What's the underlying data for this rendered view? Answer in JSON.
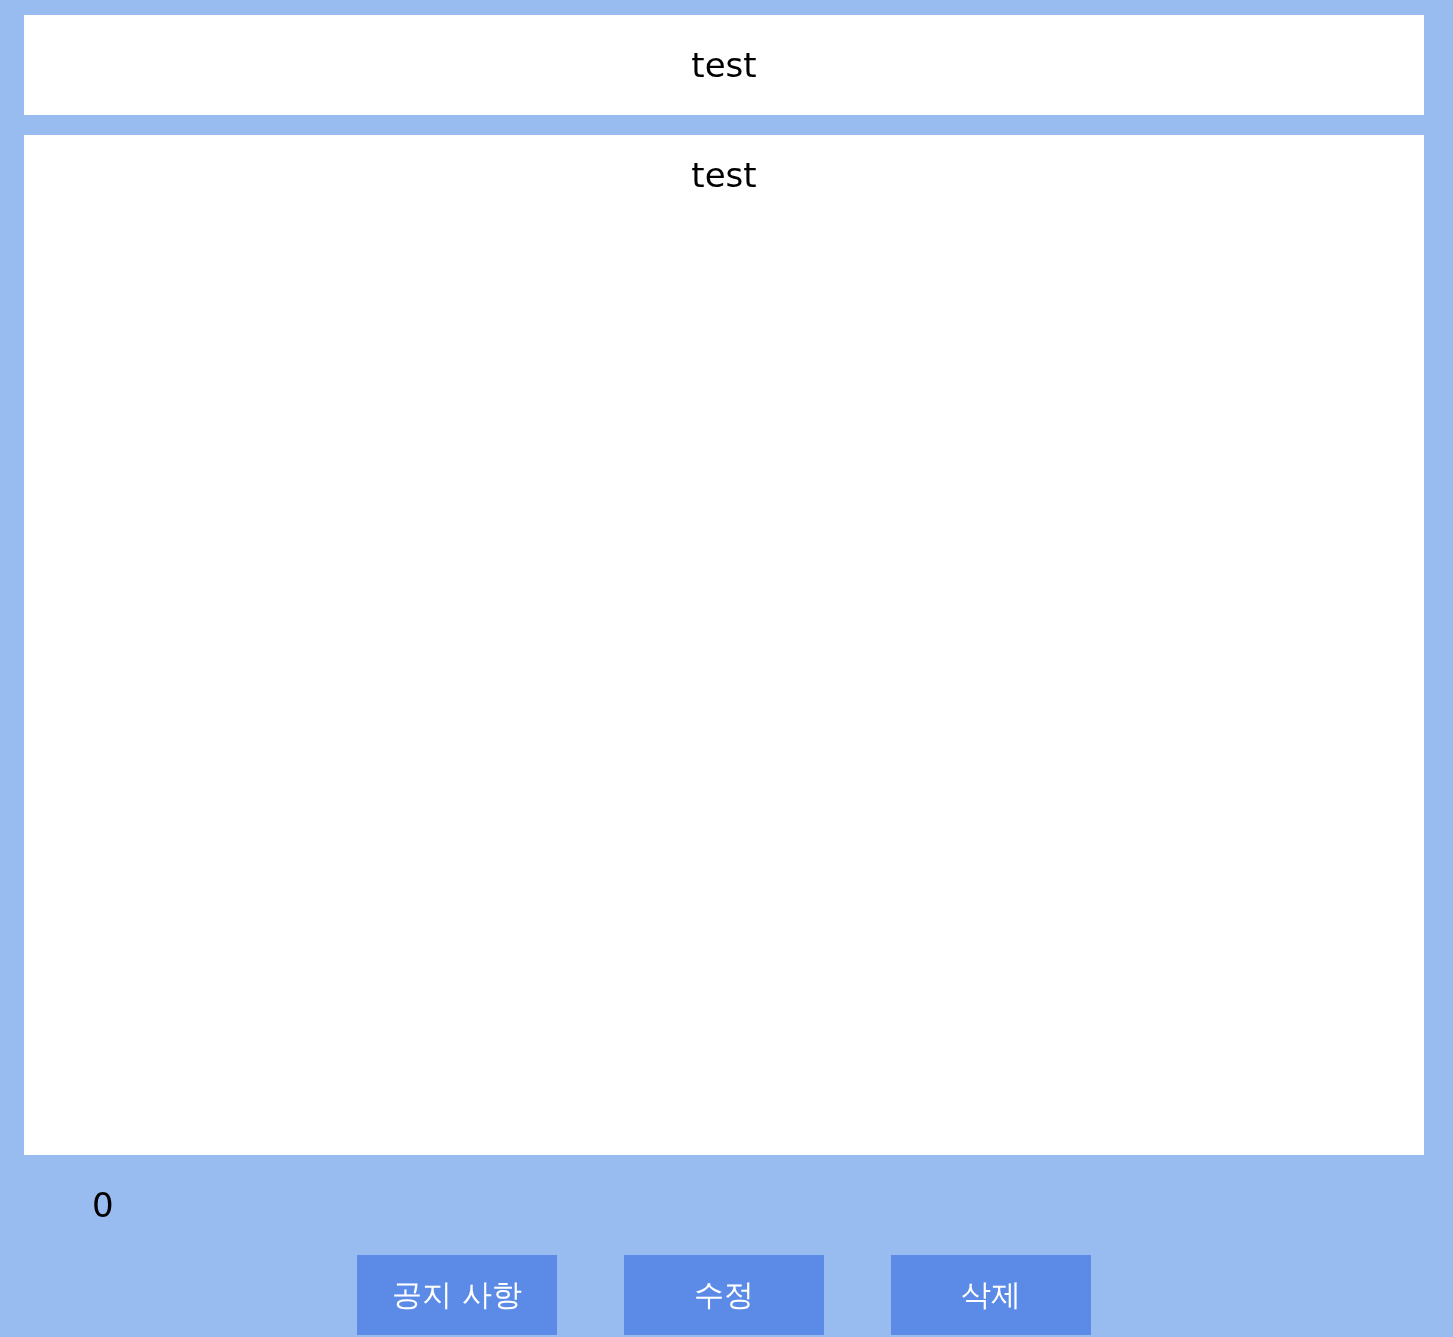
{
  "post": {
    "title": "test",
    "body": "test",
    "count": "0"
  },
  "buttons": [
    {
      "label": "공지 사항"
    },
    {
      "label": "수정"
    },
    {
      "label": "삭제"
    }
  ]
}
